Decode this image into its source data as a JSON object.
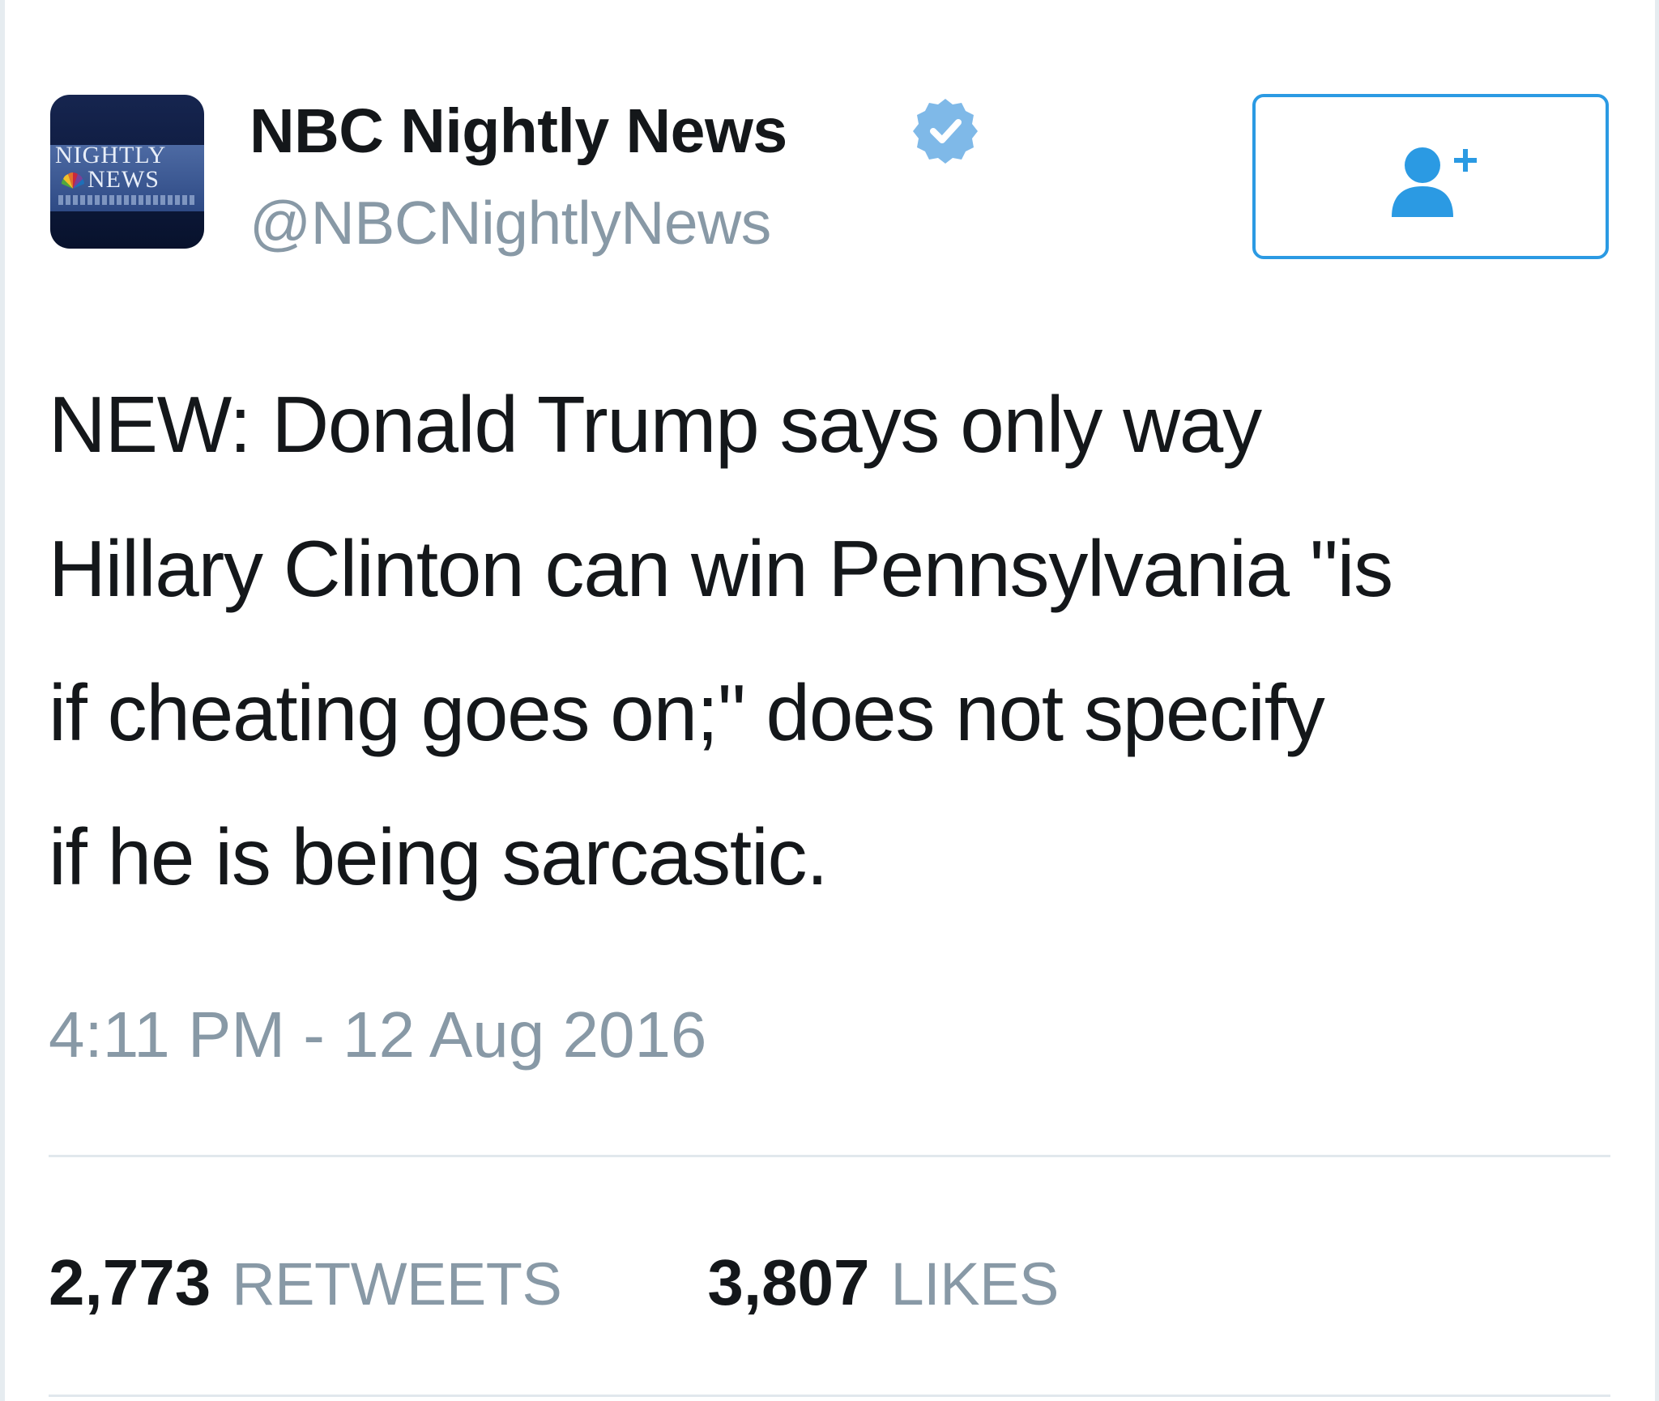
{
  "tweet": {
    "author": {
      "avatar_text_line1": "NIGHTLY",
      "avatar_text_line2": "NEWS",
      "display_name": "NBC Nightly News",
      "handle": "@NBCNightlyNews",
      "verified": true,
      "verified_icon": "verified-badge-icon",
      "verified_color": "#7fb9e8"
    },
    "follow_button": {
      "icon": "follow-user-plus-icon",
      "accent_color": "#2b9ae3"
    },
    "text_lines": [
      "NEW: Donald Trump says only way",
      "Hillary Clinton can win Pennsylvania \"is",
      "if cheating goes on;\" does not specify",
      "if he is being sarcastic."
    ],
    "timestamp": "4:11 PM - 12 Aug 2016",
    "stats": {
      "retweets_count": "2,773",
      "retweets_label": "RETWEETS",
      "likes_count": "3,807",
      "likes_label": "LIKES"
    }
  }
}
